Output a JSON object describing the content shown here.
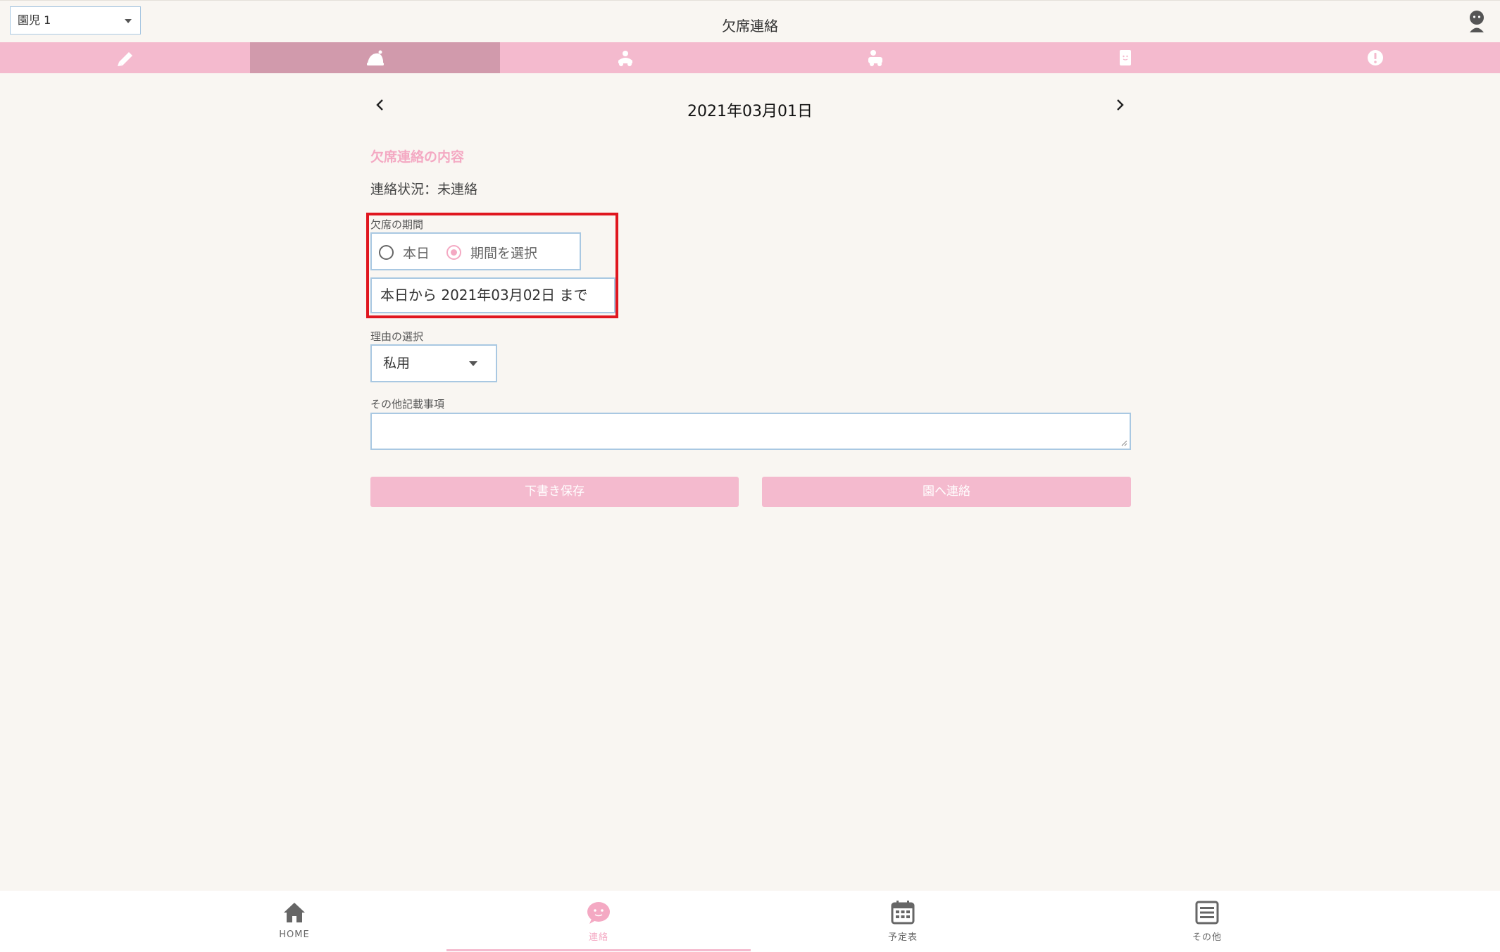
{
  "header": {
    "child_select": "園児 1",
    "title": "欠席連絡"
  },
  "tabs": [
    {
      "icon": "notebook-icon",
      "active": false
    },
    {
      "icon": "sick-child-icon",
      "active": true
    },
    {
      "icon": "pickup-icon",
      "active": false
    },
    {
      "icon": "bus-icon",
      "active": false
    },
    {
      "icon": "sticker-icon",
      "active": false
    },
    {
      "icon": "alert-icon",
      "active": false
    }
  ],
  "date_nav": {
    "date": "2021年03月01日"
  },
  "form": {
    "section_title": "欠席連絡の内容",
    "status": "連絡状況：未連絡",
    "period_label": "欠席の期間",
    "period_options": [
      {
        "label": "本日",
        "checked": false
      },
      {
        "label": "期間を選択",
        "checked": true
      }
    ],
    "period_value": "本日から  2021年03月02日  まで",
    "reason_label": "理由の選択",
    "reason_value": "私用",
    "notes_label": "その他記載事項",
    "notes_value": "",
    "save_draft_label": "下書き保存",
    "send_label": "園へ連絡"
  },
  "bottom_nav": [
    {
      "label": "HOME",
      "icon": "home-icon",
      "active": false
    },
    {
      "label": "連絡",
      "icon": "chat-icon",
      "active": true
    },
    {
      "label": "予定表",
      "icon": "calendar-icon",
      "active": false
    },
    {
      "label": "その他",
      "icon": "menu-icon",
      "active": false
    }
  ],
  "colors": {
    "accent_pink": "#f4bace",
    "active_tab": "#d19aac",
    "highlight_red": "#e0161f",
    "input_border": "#a9c8e2"
  }
}
